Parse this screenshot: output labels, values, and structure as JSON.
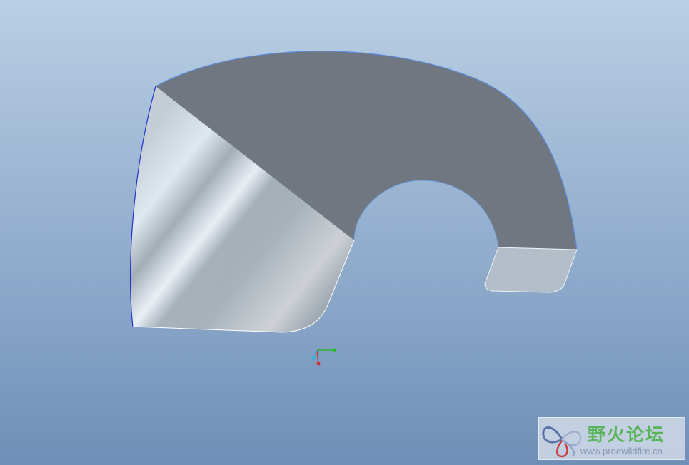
{
  "viewport": {
    "background_top": "#b9cfe4",
    "background_bottom": "#6f8fb8"
  },
  "model": {
    "top_face_color": "#707780",
    "side_face_color": "#b6c1ca",
    "end_face_color": "#b3bec8",
    "edge_highlight": "#5a8de0"
  },
  "csys": {
    "x_axis_color": "#2db52d",
    "y_axis_color": "#d22b2b",
    "z_axis_color": "#27b6d8",
    "icon": "coordinate-system-icon"
  },
  "watermark": {
    "title": "野火论坛",
    "url": "www.proewildfire.cn",
    "logo_icon": "butterfly-logo-icon"
  }
}
